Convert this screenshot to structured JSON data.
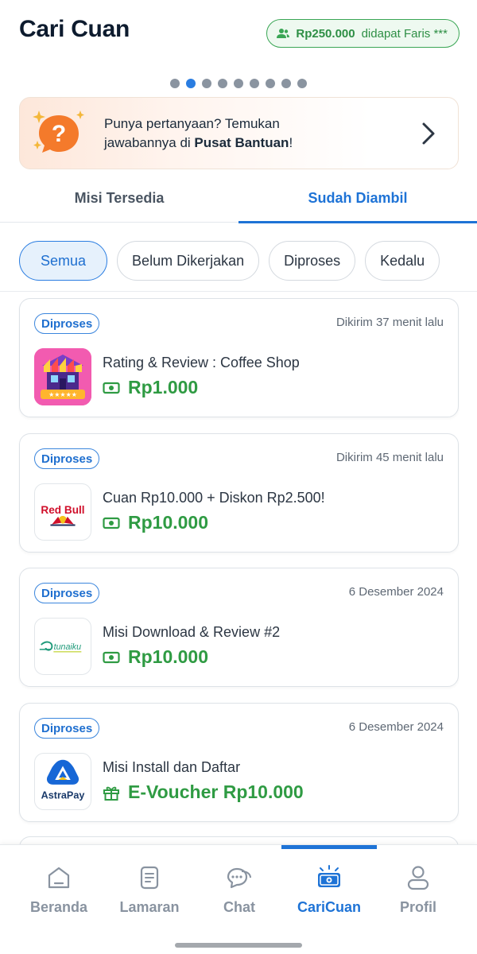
{
  "header": {
    "title": "Cari Cuan",
    "promo": {
      "amount": "Rp250.000",
      "text": "didapat Faris ***"
    }
  },
  "carousel": {
    "total_dots": 9,
    "active_index": 1
  },
  "help_banner": {
    "line1": "Punya pertanyaan? Temukan",
    "line2_prefix": "jawabannya di ",
    "line2_bold": "Pusat Bantuan",
    "line2_suffix": "!"
  },
  "tabs": [
    {
      "label": "Misi Tersedia",
      "active": false
    },
    {
      "label": "Sudah Diambil",
      "active": true
    }
  ],
  "filters": [
    {
      "label": "Semua",
      "active": true
    },
    {
      "label": "Belum Dikerjakan",
      "active": false
    },
    {
      "label": "Diproses",
      "active": false
    },
    {
      "label": "Kedalu",
      "active": false
    }
  ],
  "missions": [
    {
      "status": "Diproses",
      "time": "Dikirim 37 menit lalu",
      "title": "Rating & Review : Coffee Shop",
      "reward": "Rp1.000",
      "reward_icon": "money-icon",
      "logo": "coffee-shop-logo"
    },
    {
      "status": "Diproses",
      "time": "Dikirim 45 menit lalu",
      "title": "Cuan Rp10.000 + Diskon Rp2.500!",
      "reward": "Rp10.000",
      "reward_icon": "money-icon",
      "logo": "red-bull-logo",
      "logo_text": "Red Bull"
    },
    {
      "status": "Diproses",
      "time": "6 Desember 2024",
      "title": "Misi Download & Review #2",
      "reward": "Rp10.000",
      "reward_icon": "money-icon",
      "logo": "tunaiku-logo",
      "logo_text": "tunaiku"
    },
    {
      "status": "Diproses",
      "time": "6 Desember 2024",
      "title": "Misi Install dan Daftar",
      "reward": "E-Voucher Rp10.000",
      "reward_icon": "gift-icon",
      "logo": "astrapay-logo",
      "logo_text": "AstraPay"
    }
  ],
  "bottom_nav": [
    {
      "label": "Beranda",
      "icon": "home-icon",
      "active": false
    },
    {
      "label": "Lamaran",
      "icon": "document-icon",
      "active": false
    },
    {
      "label": "Chat",
      "icon": "chat-icon",
      "active": false
    },
    {
      "label": "CariCuan",
      "icon": "cash-icon",
      "active": true
    },
    {
      "label": "Profil",
      "icon": "profile-icon",
      "active": false
    }
  ],
  "colors": {
    "primary": "#1e73d6",
    "success": "#2f9b43",
    "muted": "#8993a0"
  }
}
